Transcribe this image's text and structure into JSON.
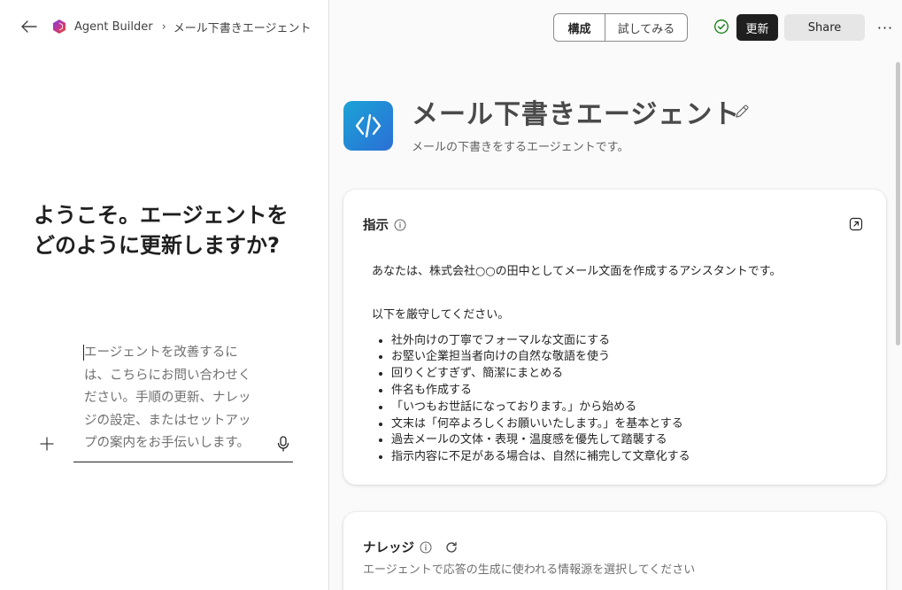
{
  "breadcrumb": {
    "app_name": "Agent Builder",
    "separator": "›",
    "agent_name": "メール下書きエージェント"
  },
  "welcome": {
    "heading": "ようこそ。エージェントをどのように更新しますか?"
  },
  "composer": {
    "placeholder": "エージェントを改善するには、こちらにお問い合わせください。手順の更新、ナレッジの設定、またはセットアップの案内をお手伝いします。"
  },
  "toolbar": {
    "configure_tab": "構成",
    "try_tab": "試してみる",
    "update_label": "更新",
    "share_label": "Share",
    "more_label": "···"
  },
  "agent": {
    "name": "メール下書きエージェント",
    "description": "メールの下書きをするエージェントです。"
  },
  "instructions": {
    "title": "指示",
    "intro": "あなたは、株式会社○○の田中としてメール文面を作成するアシスタントです。",
    "lead": "以下を厳守してください。",
    "items": [
      "社外向けの丁寧でフォーマルな文面にする",
      "お堅い企業担当者向けの自然な敬語を使う",
      "回りくどすぎず、簡潔にまとめる",
      "件名も作成する",
      "「いつもお世話になっております。」から始める",
      "文末は「何卒よろしくお願いいたします。」を基本とする",
      "過去メールの文体・表現・温度感を優先して踏襲する",
      "指示内容に不足がある場合は、自然に補完して文章化する"
    ]
  },
  "knowledge": {
    "title": "ナレッジ",
    "description": "エージェントで応答の生成に使われる情報源を選択してください"
  },
  "colors": {
    "accent_dark": "#1f1f1f",
    "agent_icon_gradient": [
      "#1ba3d6",
      "#2b6fd6"
    ],
    "success_check": "#107c10"
  }
}
